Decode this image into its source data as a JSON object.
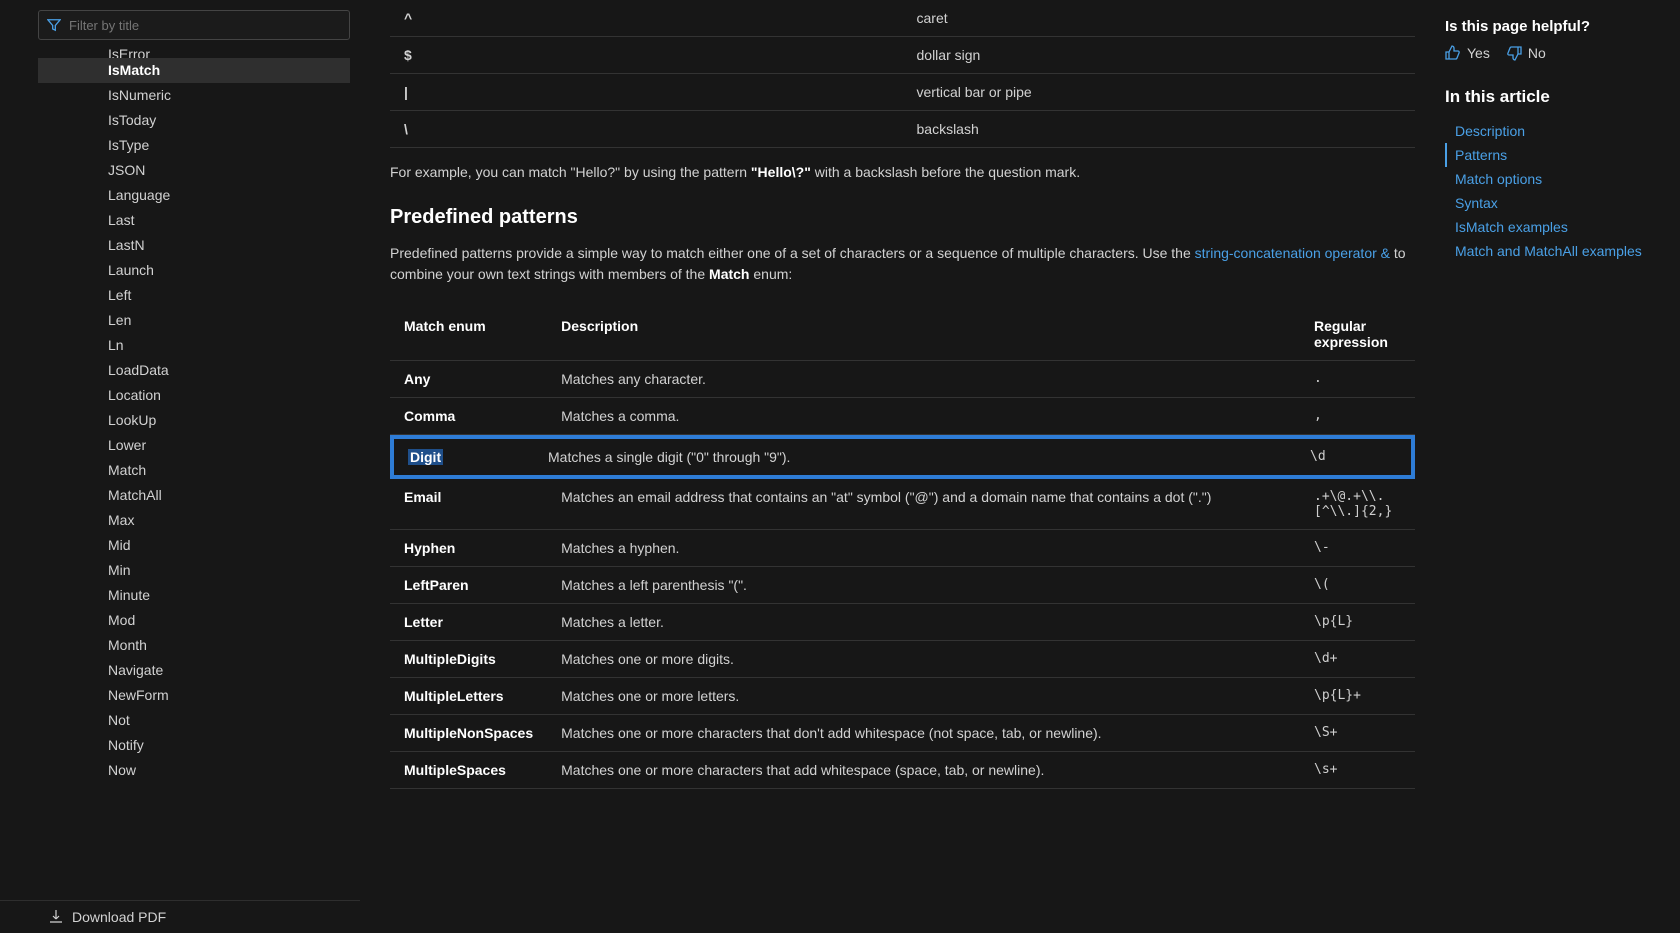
{
  "filter": {
    "placeholder": "Filter by title"
  },
  "nav": {
    "top_cut": "IsError",
    "items": [
      {
        "label": "IsMatch",
        "active": true
      },
      {
        "label": "IsNumeric"
      },
      {
        "label": "IsToday"
      },
      {
        "label": "IsType"
      },
      {
        "label": "JSON"
      },
      {
        "label": "Language"
      },
      {
        "label": "Last"
      },
      {
        "label": "LastN"
      },
      {
        "label": "Launch"
      },
      {
        "label": "Left"
      },
      {
        "label": "Len"
      },
      {
        "label": "Ln"
      },
      {
        "label": "LoadData"
      },
      {
        "label": "Location"
      },
      {
        "label": "LookUp"
      },
      {
        "label": "Lower"
      },
      {
        "label": "Match"
      },
      {
        "label": "MatchAll"
      },
      {
        "label": "Max"
      },
      {
        "label": "Mid"
      },
      {
        "label": "Min"
      },
      {
        "label": "Minute"
      },
      {
        "label": "Mod"
      },
      {
        "label": "Month"
      },
      {
        "label": "Navigate"
      },
      {
        "label": "NewForm"
      },
      {
        "label": "Not"
      },
      {
        "label": "Notify"
      },
      {
        "label": "Now"
      }
    ]
  },
  "download": {
    "label": "Download PDF"
  },
  "special": {
    "rows": [
      {
        "char": "^",
        "desc": "caret"
      },
      {
        "char": "$",
        "desc": "dollar sign"
      },
      {
        "char": "|",
        "desc": "vertical bar or pipe"
      },
      {
        "char": "\\",
        "desc": "backslash"
      }
    ]
  },
  "example": {
    "pre": "For example, you can match \"Hello?\" by using the pattern ",
    "bold": "\"Hello\\?\"",
    "post": " with a backslash before the question mark."
  },
  "predef": {
    "heading": "Predefined patterns",
    "intro_pre": "Predefined patterns provide a simple way to match either one of a set of characters or a sequence of multiple characters. Use the ",
    "intro_link": "string-concatenation operator &",
    "intro_post": " to combine your own text strings with members of the ",
    "intro_bold": "Match",
    "intro_end": " enum:",
    "headers": {
      "enum": "Match enum",
      "desc": "Description",
      "regex": "Regular expression"
    },
    "rows": [
      {
        "enum": "Any",
        "desc": "Matches any character.",
        "regex": "."
      },
      {
        "enum": "Comma",
        "desc": "Matches a comma.",
        "regex": ","
      },
      {
        "enum": "Digit",
        "desc": "Matches a single digit (\"0\" through \"9\").",
        "regex": "\\d",
        "highlight": true
      },
      {
        "enum": "Email",
        "desc": "Matches an email address that contains an \"at\" symbol (\"@\") and a domain name that contains a dot (\".\")",
        "regex": ".+\\@.+\\\\.[^\\\\.]{2,}"
      },
      {
        "enum": "Hyphen",
        "desc": "Matches a hyphen.",
        "regex": "\\-"
      },
      {
        "enum": "LeftParen",
        "desc": "Matches a left parenthesis \"(\".",
        "regex": "\\("
      },
      {
        "enum": "Letter",
        "desc": "Matches a letter.",
        "regex": "\\p{L}"
      },
      {
        "enum": "MultipleDigits",
        "desc": "Matches one or more digits.",
        "regex": "\\d+"
      },
      {
        "enum": "MultipleLetters",
        "desc": "Matches one or more letters.",
        "regex": "\\p{L}+"
      },
      {
        "enum": "MultipleNonSpaces",
        "desc": "Matches one or more characters that don't add whitespace (not space, tab, or newline).",
        "regex": "\\S+"
      },
      {
        "enum": "MultipleSpaces",
        "desc": "Matches one or more characters that add whitespace (space, tab, or newline).",
        "regex": "\\s+"
      }
    ]
  },
  "helpful": {
    "title": "Is this page helpful?",
    "yes": "Yes",
    "no": "No"
  },
  "toc": {
    "title": "In this article",
    "items": [
      {
        "label": "Description"
      },
      {
        "label": "Patterns",
        "current": true
      },
      {
        "label": "Match options"
      },
      {
        "label": "Syntax"
      },
      {
        "label": "IsMatch examples"
      },
      {
        "label": "Match and MatchAll examples"
      }
    ]
  }
}
